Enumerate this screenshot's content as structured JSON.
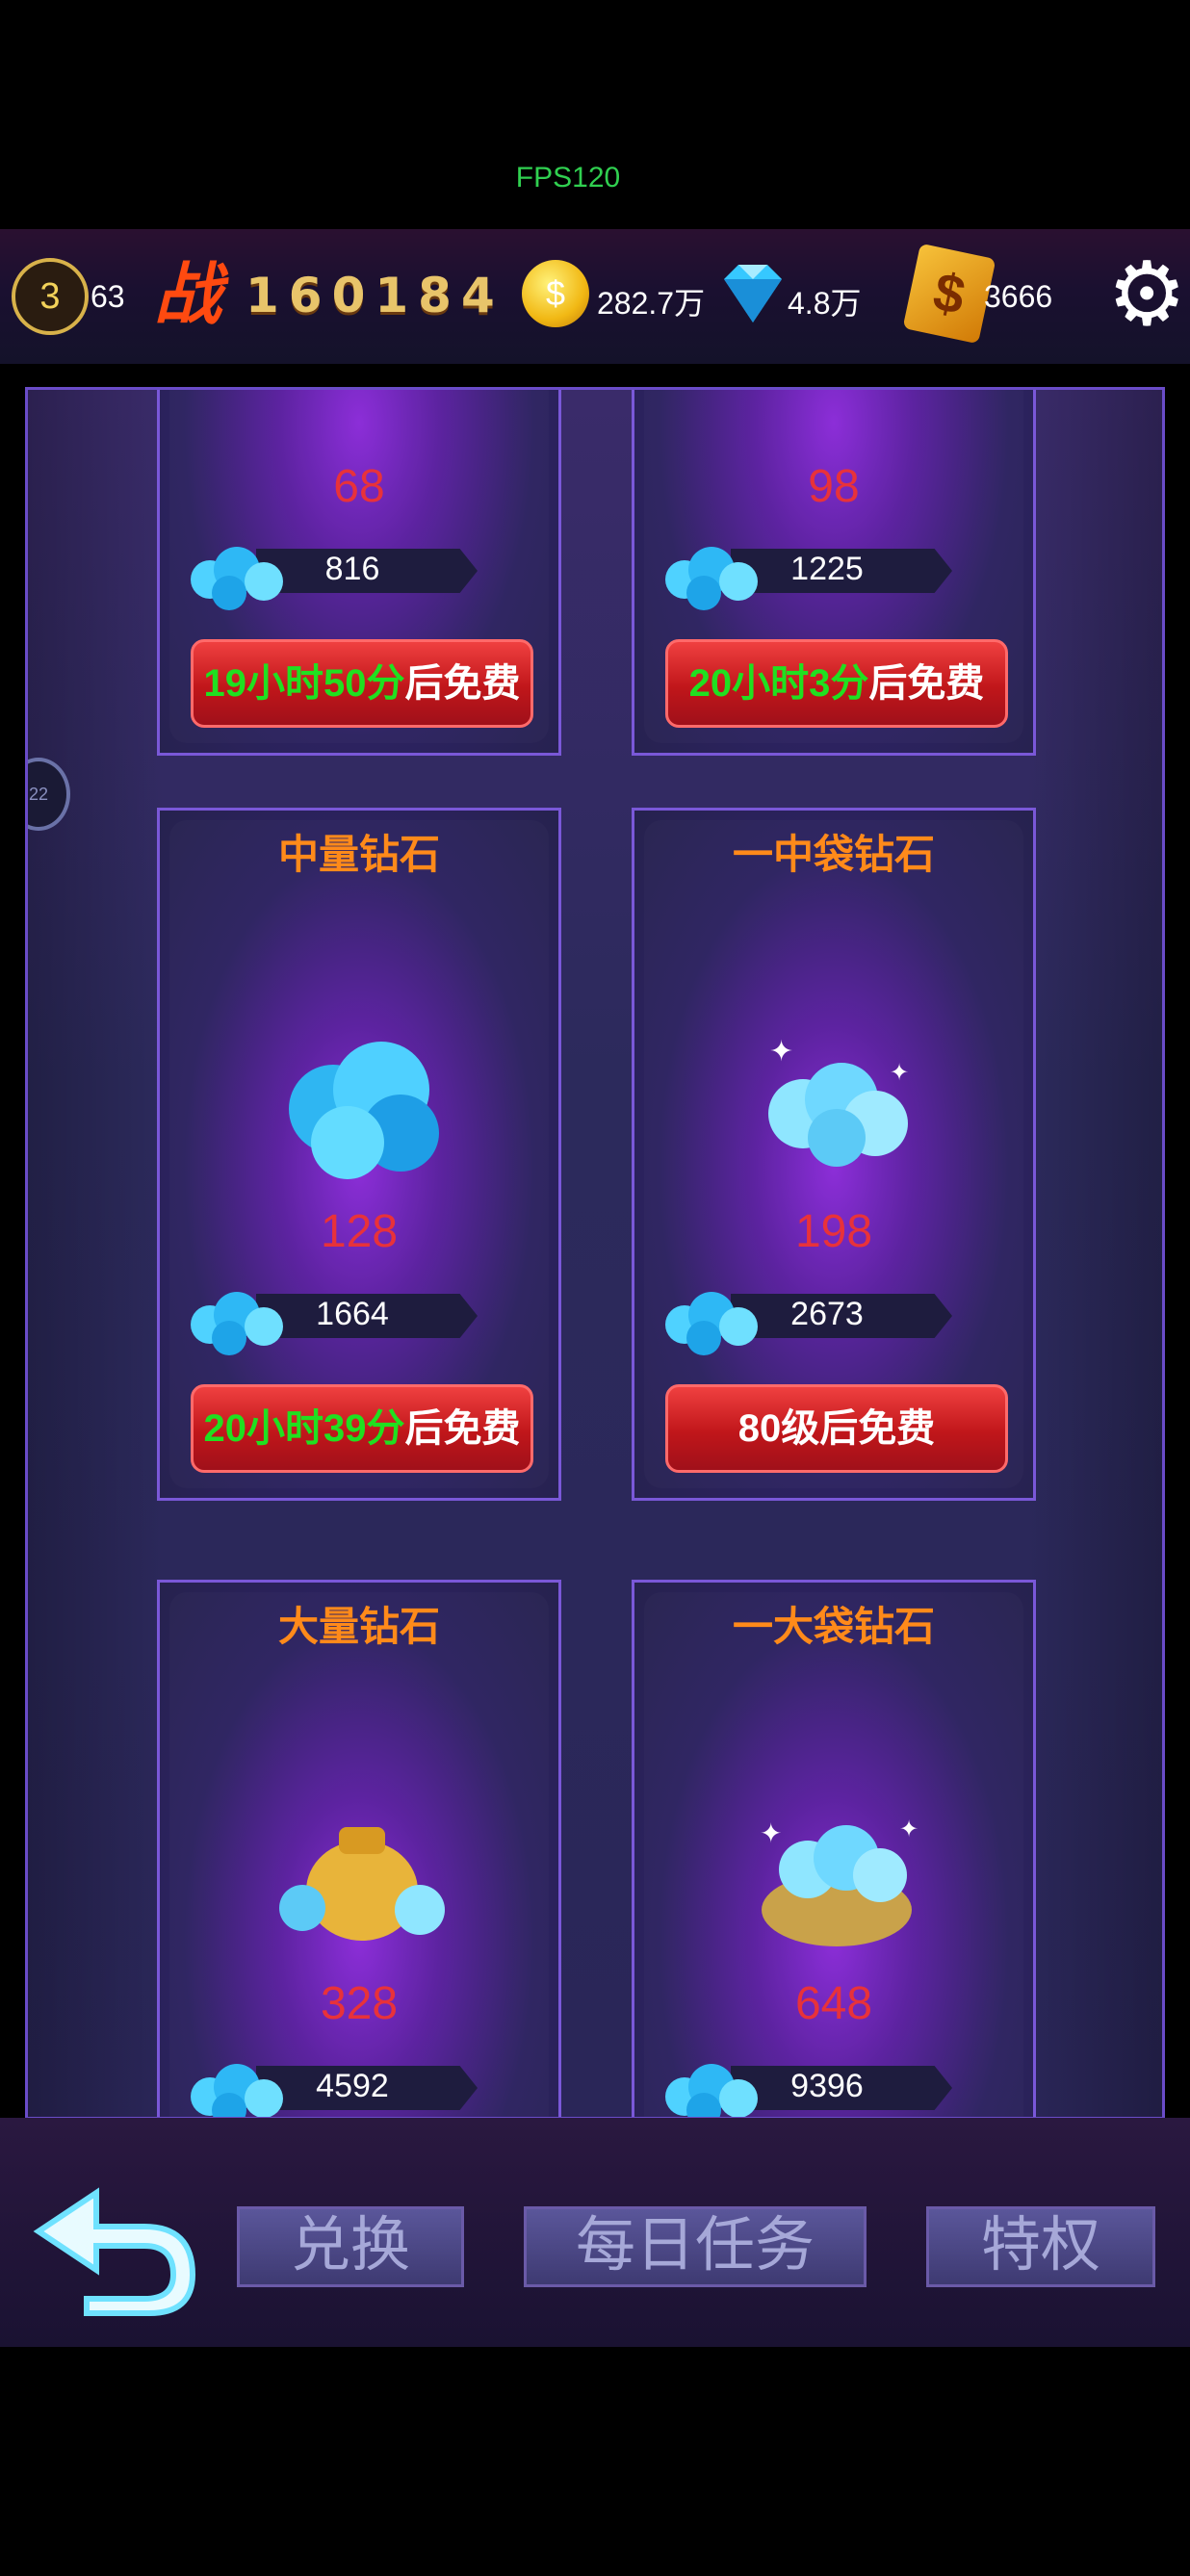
{
  "fps": "FPS120",
  "topbar": {
    "level": "3",
    "energy": "63",
    "power_label": "战",
    "power": "160184",
    "gold": "282.7万",
    "diamond": "4.8万",
    "card": "3666"
  },
  "shop": {
    "items": [
      {
        "name": "",
        "price": "68",
        "qty": "816",
        "free_time": "19小时50分",
        "free_suffix": "后免费",
        "free_text": ""
      },
      {
        "name": "",
        "price": "98",
        "qty": "1225",
        "free_time": "20小时3分",
        "free_suffix": "后免费",
        "free_text": ""
      },
      {
        "name": "中量钻石",
        "price": "128",
        "qty": "1664",
        "free_time": "20小时39分",
        "free_suffix": "后免费",
        "free_text": ""
      },
      {
        "name": "一中袋钻石",
        "price": "198",
        "qty": "2673",
        "free_time": "",
        "free_suffix": "",
        "free_text": "80级后免费"
      },
      {
        "name": "大量钻石",
        "price": "328",
        "qty": "4592"
      },
      {
        "name": "一大袋钻石",
        "price": "648",
        "qty": "9396"
      }
    ]
  },
  "bottom": {
    "tabs": [
      "兑换",
      "每日任务",
      "特权"
    ]
  },
  "colors": {
    "accent_orange": "#ff8a1a",
    "price_red": "#e8323a",
    "timer_green": "#20e020"
  }
}
